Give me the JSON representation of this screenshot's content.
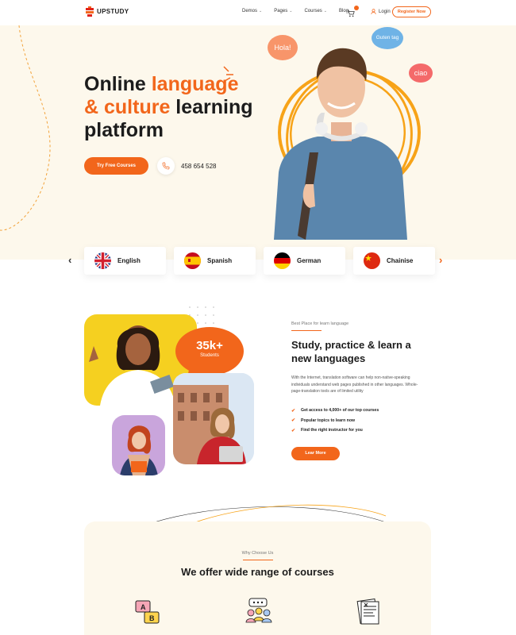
{
  "brand": {
    "name": "UPSTUDY",
    "accent": "#f2661b",
    "cream": "#fdf8ec"
  },
  "nav": {
    "items": [
      {
        "label": "Demos",
        "dropdown": true
      },
      {
        "label": "Pages",
        "dropdown": true
      },
      {
        "label": "Courses",
        "dropdown": true
      },
      {
        "label": "Blog",
        "dropdown": false
      }
    ],
    "cart_icon": "cart-icon",
    "login_label": "Login",
    "register_label": "Register Now"
  },
  "hero": {
    "title_part1": "Online ",
    "title_accent1": "language",
    "title_accent2": "& culture",
    "title_part2": " learning platform",
    "cta_label": "Try Free Courses",
    "phone": "458 654 528",
    "bubbles": [
      "Hola!",
      "Guten tag",
      "ciao"
    ]
  },
  "languages": [
    {
      "name": "English",
      "flag": "uk-flag-icon"
    },
    {
      "name": "Spanish",
      "flag": "spain-flag-icon"
    },
    {
      "name": "German",
      "flag": "germany-flag-icon"
    },
    {
      "name": "Chainise",
      "flag": "china-flag-icon"
    }
  ],
  "about": {
    "label": "Best  Place for learn language",
    "title": "Study, practice & learn a new languages",
    "description": "With the Internet, translation software can help non-native-speaking individuals understand web pages published in other languages. Whole-page-translation tools are of limited utility",
    "checks": [
      "Get access to 4,000+ of our top courses",
      "Popular topics to learn now",
      "Find the right instructor for you"
    ],
    "cta_label": "Lear More",
    "stat_number": "35k+",
    "stat_label": "Students"
  },
  "why": {
    "label": "Why Choose Us",
    "title": "We offer wide range of courses",
    "icons": [
      "translate-icon",
      "group-chat-icon",
      "certificate-icon"
    ]
  }
}
